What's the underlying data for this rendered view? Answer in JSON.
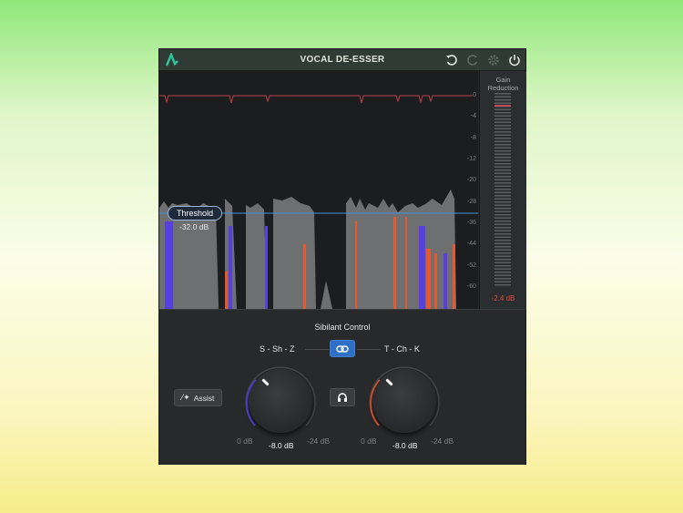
{
  "header": {
    "title": "VOCAL DE-ESSER",
    "icons": [
      "logo-icon",
      "undo-icon",
      "redo-icon",
      "settings-icon",
      "power-icon"
    ]
  },
  "graph": {
    "scale": [
      "0",
      "-4",
      "-8",
      "-12",
      "-20",
      "-28",
      "-36",
      "-44",
      "-52",
      "-60"
    ],
    "threshold_label": "Threshold",
    "threshold_value": "-32.0 dB"
  },
  "meter": {
    "label_line1": "Gain",
    "label_line2": "Reduction",
    "value": "-2.4 dB",
    "value_color": "#e0473f"
  },
  "controls": {
    "section_title": "Sibilant Control",
    "left_band": "S - Sh - Z",
    "right_band": "T - Ch - K",
    "assist_label": "Assist",
    "left_knob": {
      "min": "0 dB",
      "value": "-8.0 dB",
      "max": "-24 dB",
      "color": "#5a3fe0"
    },
    "right_knob": {
      "min": "0 dB",
      "value": "-8.0 dB",
      "max": "-24 dB",
      "color": "#e8582f"
    }
  },
  "colors": {
    "accent": "#2f6fc4",
    "sibilant_s": "#5a3fe0",
    "sibilant_t": "#e8582f"
  }
}
